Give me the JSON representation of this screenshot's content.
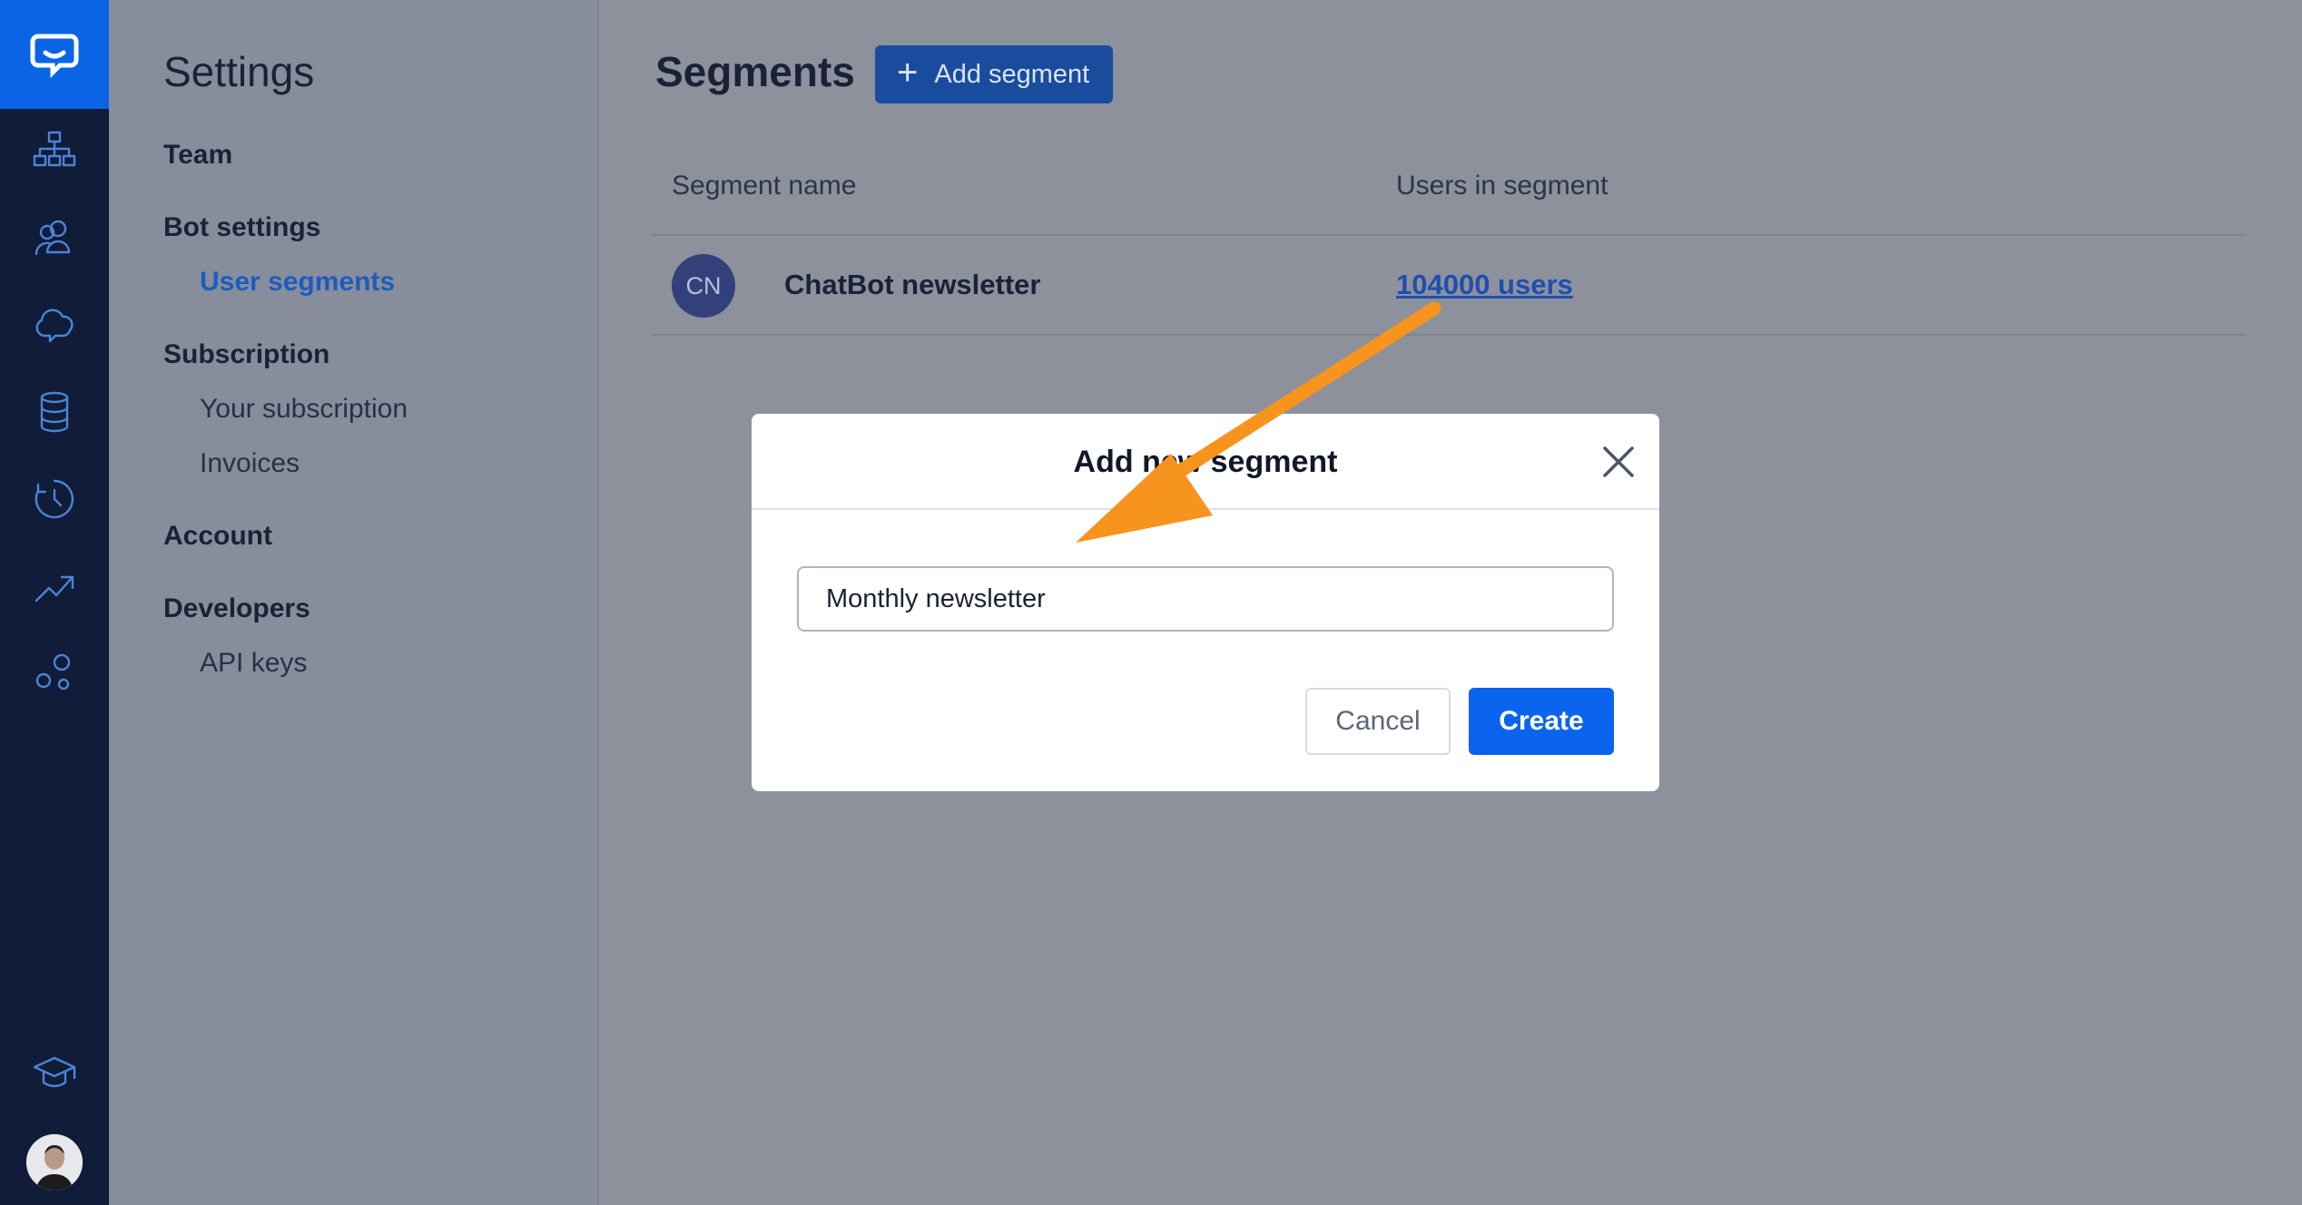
{
  "settings": {
    "title": "Settings",
    "groups": {
      "team": "Team",
      "bot_settings": "Bot settings",
      "user_segments": "User segments",
      "subscription": "Subscription",
      "your_subscription": "Your subscription",
      "invoices": "Invoices",
      "account": "Account",
      "developers": "Developers",
      "api_keys": "API keys"
    }
  },
  "main": {
    "title": "Segments",
    "add_button_label": "Add segment",
    "table": {
      "columns": [
        "Segment name",
        "Users in segment"
      ],
      "rows": [
        {
          "initials": "CN",
          "name": "ChatBot newsletter",
          "users": "104000 users"
        }
      ]
    }
  },
  "modal": {
    "title": "Add new segment",
    "input_value": "Monthly newsletter",
    "cancel_label": "Cancel",
    "create_label": "Create"
  },
  "colors": {
    "accent": "#0a64f0",
    "rail_bg": "#101c38",
    "annotation": "#f7941d"
  },
  "icons": [
    "chat-logo-icon",
    "hierarchy-icon",
    "users-icon",
    "cloud-icon",
    "database-icon",
    "history-icon",
    "trend-icon",
    "bubbles-icon",
    "graduation-cap-icon"
  ]
}
